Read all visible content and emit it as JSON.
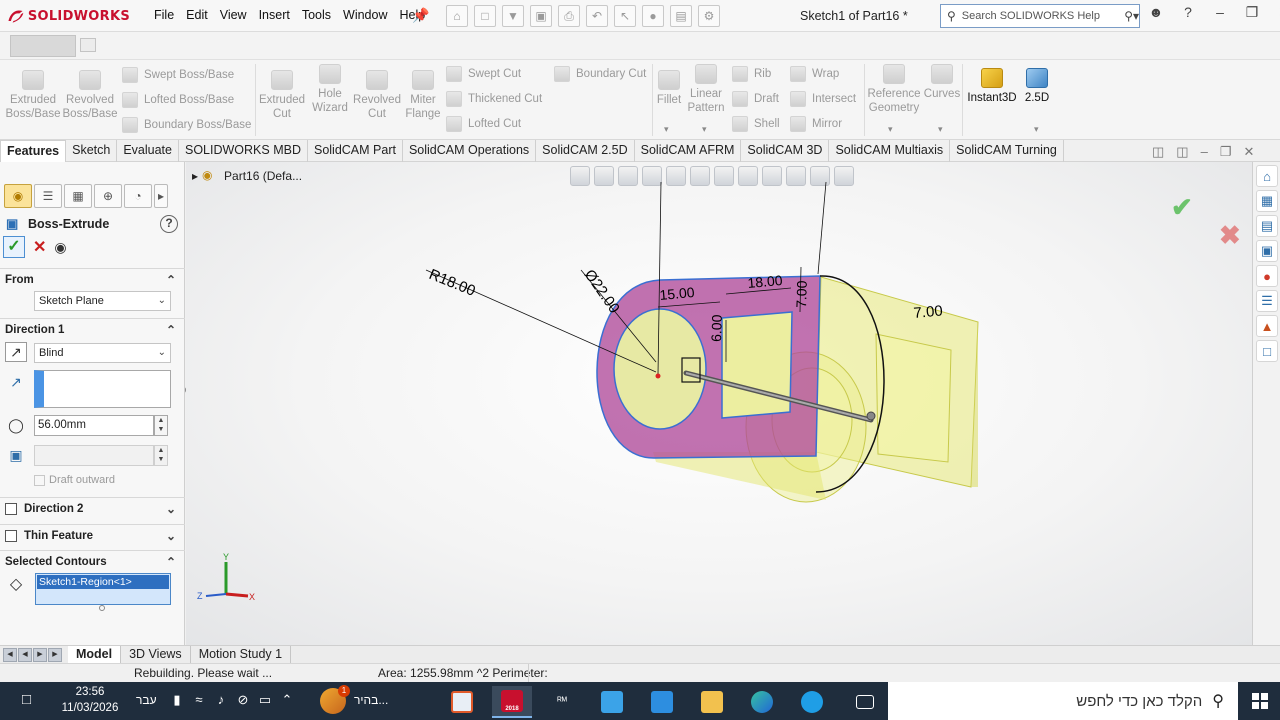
{
  "app": {
    "brand": "SOLIDWORKS",
    "doc_title": "Sketch1 of Part16 *",
    "menus": [
      "File",
      "Edit",
      "View",
      "Insert",
      "Tools",
      "Window",
      "Help"
    ],
    "search_placeholder": "Search SOLIDWORKS Help"
  },
  "ribbon": {
    "extruded_boss": "Extruded\nBoss/Base",
    "revolved_boss": "Revolved\nBoss/Base",
    "swept_boss": "Swept Boss/Base",
    "lofted_boss": "Lofted Boss/Base",
    "boundary_boss": "Boundary Boss/Base",
    "extruded_cut": "Extruded\nCut",
    "hole_wizard": "Hole\nWizard",
    "revolved_cut": "Revolved\nCut",
    "miter_flange": "Miter\nFlange",
    "swept_cut": "Swept Cut",
    "thickened_cut": "Thickened Cut",
    "lofted_cut": "Lofted Cut",
    "boundary_cut": "Boundary Cut",
    "fillet": "Fillet",
    "linear_pattern": "Linear\nPattern",
    "rib": "Rib",
    "draft": "Draft",
    "shell": "Shell",
    "wrap": "Wrap",
    "intersect": "Intersect",
    "mirror": "Mirror",
    "reference_geometry": "Reference\nGeometry",
    "curves": "Curves",
    "instant3d": "Instant3D",
    "d25": "2.5D"
  },
  "tabs": [
    "Features",
    "Sketch",
    "Evaluate",
    "SOLIDWORKS MBD",
    "SolidCAM Part",
    "SolidCAM Operations",
    "SolidCAM 2.5D",
    "SolidCAM AFRM",
    "SolidCAM 3D",
    "SolidCAM Multiaxis",
    "SolidCAM Turning"
  ],
  "property_manager": {
    "title": "Boss-Extrude",
    "help": "?",
    "from": {
      "label": "From",
      "value": "Sketch Plane"
    },
    "direction1": {
      "label": "Direction 1",
      "end_condition": "Blind",
      "depth": "56.00mm",
      "draft_outward": "Draft outward"
    },
    "direction2": {
      "label": "Direction 2"
    },
    "thin_feature": {
      "label": "Thin Feature"
    },
    "selected_contours": {
      "label": "Selected Contours",
      "items": [
        "Sketch1-Region<1>"
      ]
    }
  },
  "graphics": {
    "tree_crumb": "Part16  (Defa...",
    "dimensions": {
      "r18": "R18.00",
      "d22": "Ø22.00",
      "d15": "15.00",
      "d18": "18.00",
      "d7_top": "7.00",
      "d6": "6.00",
      "d7_right": "7.00"
    },
    "triad": {
      "x": "X",
      "y": "Y",
      "z": "Z"
    }
  },
  "bottom_tabs": [
    "Model",
    "3D Views",
    "Motion Study 1"
  ],
  "status": {
    "rebuild": "Rebuilding. Please wait ...",
    "area": "Area: 1255.98mm ^2 Perimeter:"
  },
  "taskbar": {
    "time": "23:56",
    "date": "11/03/2026",
    "lang": "עבר",
    "weather_text": "בהיר...",
    "weather_badge": "1",
    "search_text": "הקלד כאן כדי לחפש",
    "sw_badge": "2018"
  },
  "colors": {
    "brand_red": "#c8102e",
    "selection_blue": "#2e6fc0",
    "model_yellow": "#e9eb74",
    "model_magenta": "#b04a9a",
    "taskbar": "#1f2d3d"
  }
}
